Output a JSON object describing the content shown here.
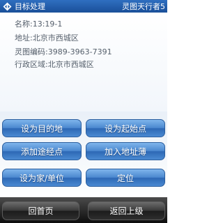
{
  "titlebar": {
    "icon": "diamond-arrows-icon",
    "title": "目标处理",
    "right_text": "灵图天行者5"
  },
  "info": {
    "rows": [
      {
        "label": "名称:",
        "value": "13:19-1"
      },
      {
        "label": "地址:",
        "value": "北京市西城区"
      },
      {
        "label": "灵图编码:",
        "value": "3989-3963-7391"
      },
      {
        "label": "行政区域:",
        "value": "北京市西城区"
      }
    ]
  },
  "actions": {
    "set_destination": "设为目的地",
    "set_start": "设为起始点",
    "add_waypoint": "添加途经点",
    "add_to_address_book": "加入地址薄",
    "set_home_work": "设为家/单位",
    "locate": "定位"
  },
  "bottom": {
    "home": "回首页",
    "back": "返回上级"
  },
  "colors": {
    "titlebar": "#1f5aa8",
    "button_blue": "#4b88cf",
    "bottom_bar": "#1a1a1a"
  }
}
